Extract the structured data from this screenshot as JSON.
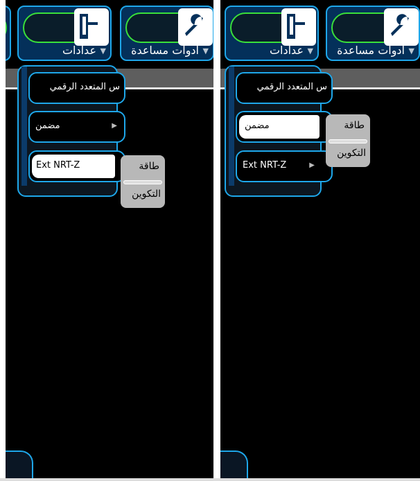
{
  "panels": [
    {
      "id": "left",
      "tools": {
        "settings_label": "عدادات",
        "help_label": "ادوات مساعدة"
      },
      "menu": {
        "items": [
          {
            "label": "س المتعدد الرقمي"
          },
          {
            "label": "مضمن"
          },
          {
            "label": "Ext NRT-Z"
          }
        ],
        "selected_index": 2
      },
      "submenu": {
        "item1": "طاقة",
        "item2": "التكوين"
      }
    },
    {
      "id": "right",
      "tools": {
        "settings_label": "عدادات",
        "help_label": "ادوات مساعدة"
      },
      "menu": {
        "items": [
          {
            "label": "س المتعدد الرقمي"
          },
          {
            "label": "مضمن"
          },
          {
            "label": "Ext NRT-Z"
          }
        ],
        "selected_index": 1
      },
      "submenu": {
        "item1": "طاقة",
        "item2": "التكوين"
      }
    }
  ],
  "icons": {
    "settings": "meter-panel-icon",
    "help": "wrench-icon",
    "more": "chevron-down-icon"
  },
  "colors": {
    "accent": "#1ea7ea",
    "pill": "#3adf3a",
    "background": "#000000",
    "submenu": "#b8b8b8"
  }
}
